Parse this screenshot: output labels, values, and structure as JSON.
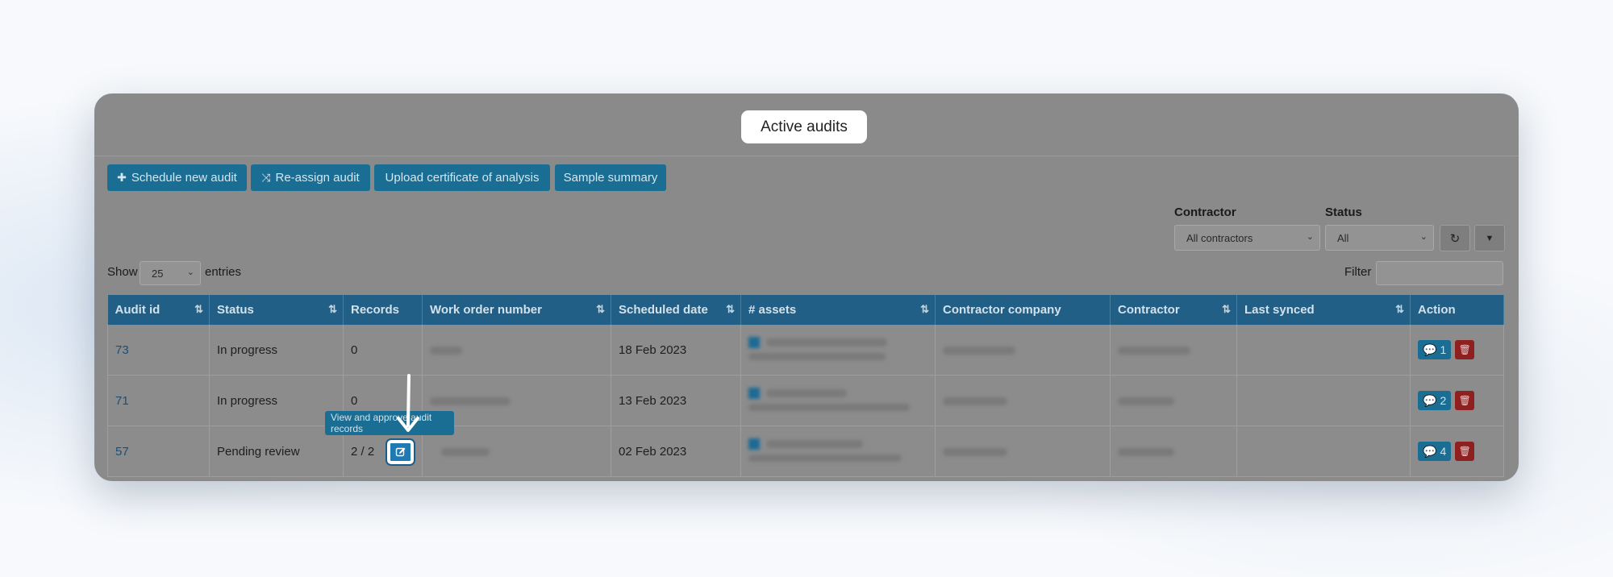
{
  "window": {
    "title": "Active audits"
  },
  "toolbar": {
    "schedule": {
      "glyph": "✚",
      "label": "Schedule new audit"
    },
    "reassign": {
      "glyph": "⤨",
      "label": "Re-assign audit"
    },
    "upload": {
      "label": "Upload certificate of analysis"
    },
    "summary": {
      "label": "Sample summary"
    }
  },
  "filters": {
    "contractor_label": "Contractor",
    "contractor_value": "All contractors",
    "status_label": "Status",
    "status_value": "All",
    "reset_icon": "↻",
    "filter_icon": "▼"
  },
  "length": {
    "show": "Show",
    "value": "25",
    "entries": "entries"
  },
  "search": {
    "label": "Filter"
  },
  "table": {
    "headers": [
      "Audit id",
      "Status",
      "Records",
      "Work order number",
      "Scheduled date",
      "# assets",
      "Contractor company",
      "Contractor",
      "Last synced",
      "Action"
    ],
    "sort_glyph": "⇅",
    "rows": [
      {
        "id": "73",
        "status": "In progress",
        "records": "0",
        "date": "18 Feb 2023",
        "comments": "1"
      },
      {
        "id": "71",
        "status": "In progress",
        "records": "0",
        "date": "13 Feb 2023",
        "comments": "2"
      },
      {
        "id": "57",
        "status": "Pending review",
        "records": "2 / 2",
        "date": "02 Feb 2023",
        "comments": "4"
      }
    ]
  },
  "tooltip": {
    "text": "View and approve audit records"
  },
  "icons": {
    "comment": "comment-icon",
    "trash": "trash-icon",
    "edit": "edit-icon"
  },
  "colors": {
    "primary": "#1a6d93",
    "header": "#215f86",
    "danger": "#8f2020"
  }
}
